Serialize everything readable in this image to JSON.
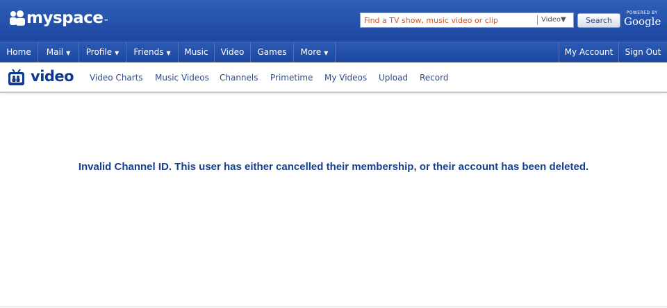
{
  "header": {
    "logo_text": "myspace",
    "logo_tm": "™",
    "search": {
      "placeholder": "Find a TV show, music video or clip",
      "scope": "Video▼",
      "button_label": "Search"
    },
    "powered_by_label": "POWERED BY",
    "powered_by_brand": "Google"
  },
  "nav": {
    "items": [
      {
        "label": "Home",
        "dropdown": ""
      },
      {
        "label": "Mail",
        "dropdown": "▼"
      },
      {
        "label": "Profile",
        "dropdown": "▼"
      },
      {
        "label": "Friends",
        "dropdown": "▼"
      },
      {
        "label": "Music",
        "dropdown": ""
      },
      {
        "label": "Video",
        "dropdown": ""
      },
      {
        "label": "Games",
        "dropdown": ""
      },
      {
        "label": "More",
        "dropdown": "▼"
      }
    ],
    "right_items": [
      {
        "label": "My Account"
      },
      {
        "label": "Sign Out"
      }
    ]
  },
  "subheader": {
    "title": "video",
    "links": [
      "Video Charts",
      "Music Videos",
      "Channels",
      "Primetime",
      "My Videos",
      "Upload",
      "Record"
    ]
  },
  "main": {
    "message": "Invalid Channel ID. This user has either cancelled their membership, or their account has been deleted."
  },
  "colors": {
    "header_blue": "#1c46a1",
    "accent_text": "#163f8f",
    "search_placeholder": "#d9531e"
  }
}
